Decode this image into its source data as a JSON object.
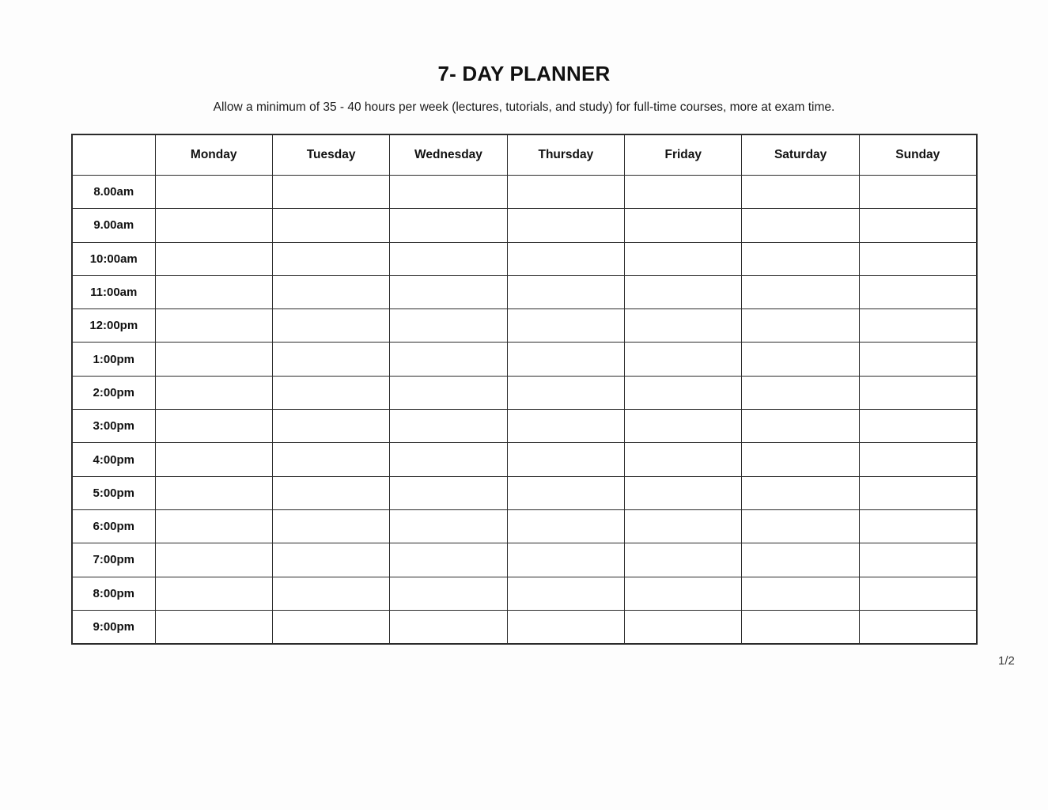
{
  "document": {
    "title": "7- DAY PLANNER",
    "subtitle": "Allow a minimum of 35 - 40 hours per week (lectures, tutorials, and study) for full-time courses, more at exam time.",
    "page_number": "1/2"
  },
  "table": {
    "corner_header": "",
    "day_headers": [
      "Monday",
      "Tuesday",
      "Wednesday",
      "Thursday",
      "Friday",
      "Saturday",
      "Sunday"
    ],
    "time_rows": [
      "8.00am",
      "9.00am",
      "10:00am",
      "11:00am",
      "12:00pm",
      "1:00pm",
      "2:00pm",
      "3:00pm",
      "4:00pm",
      "5:00pm",
      "6:00pm",
      "7:00pm",
      "8:00pm",
      "9:00pm"
    ],
    "cells": [
      [
        "",
        "",
        "",
        "",
        "",
        "",
        ""
      ],
      [
        "",
        "",
        "",
        "",
        "",
        "",
        ""
      ],
      [
        "",
        "",
        "",
        "",
        "",
        "",
        ""
      ],
      [
        "",
        "",
        "",
        "",
        "",
        "",
        ""
      ],
      [
        "",
        "",
        "",
        "",
        "",
        "",
        ""
      ],
      [
        "",
        "",
        "",
        "",
        "",
        "",
        ""
      ],
      [
        "",
        "",
        "",
        "",
        "",
        "",
        ""
      ],
      [
        "",
        "",
        "",
        "",
        "",
        "",
        ""
      ],
      [
        "",
        "",
        "",
        "",
        "",
        "",
        ""
      ],
      [
        "",
        "",
        "",
        "",
        "",
        "",
        ""
      ],
      [
        "",
        "",
        "",
        "",
        "",
        "",
        ""
      ],
      [
        "",
        "",
        "",
        "",
        "",
        "",
        ""
      ],
      [
        "",
        "",
        "",
        "",
        "",
        "",
        ""
      ],
      [
        "",
        "",
        "",
        "",
        "",
        "",
        ""
      ]
    ]
  },
  "colors": {
    "page_background": "#fdfdfd",
    "cell_background": "#ffffff",
    "border": "#2b2b2b",
    "text": "#111111"
  }
}
